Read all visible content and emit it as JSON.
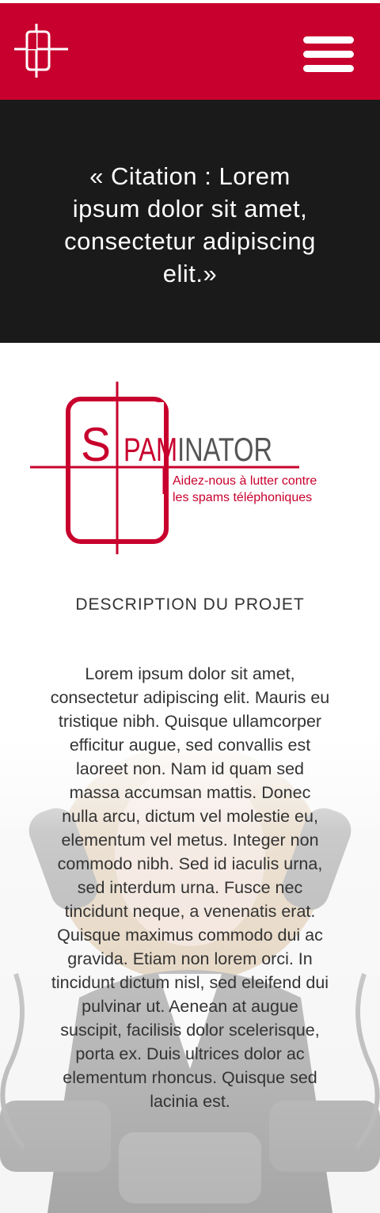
{
  "header": {
    "logo_icon": "crosshair-logo-icon",
    "menu_icon": "hamburger-menu-icon",
    "colors": {
      "brand": "#c8002d",
      "text": "#ffffff"
    }
  },
  "quote": {
    "text": "« Citation : Lorem ipsum dolor sit amet, consectetur adipiscing elit.»"
  },
  "brand_logo": {
    "letter": "S",
    "name_part1": "PAM",
    "name_part2": "INATOR",
    "tagline_line1": "Aidez-nous à lutter contre",
    "tagline_line2": "les spams téléphoniques",
    "colors": {
      "red": "#c8002d",
      "gray": "#555555"
    }
  },
  "description": {
    "title": "DESCRIPTION DU PROJET",
    "body": "Lorem ipsum dolor sit amet, consectetur adipiscing elit. Mauris eu tristique nibh. Quisque ullamcorper efficitur augue, sed convallis est laoreet non. Nam id quam sed massa accumsan mattis. Donec nulla arcu, dictum vel molestie eu, elementum vel metus. Integer non commodo nibh. Sed id iaculis urna, sed interdum urna. Fusce nec tincidunt neque, a venenatis erat. Quisque maximus commodo dui ac gravida. Etiam non lorem orci. In tincidunt dictum nisl, sed eleifend dui pulvinar ut. Aenean at augue suscipit, facilisis dolor scelerisque, porta ex. Duis ultrices dolor ac elementum rhoncus. Quisque sed lacinia est.",
    "background_image": "woman-with-phones-photo"
  }
}
